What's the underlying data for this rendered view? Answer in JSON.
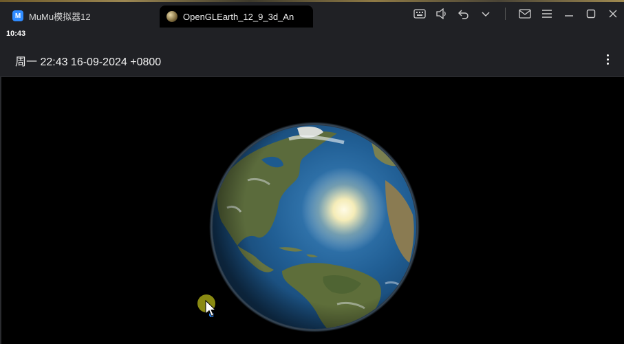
{
  "window": {
    "app_title": "MuMu模拟器12",
    "app_logo": "M",
    "active_tab_title": "OpenGLEarth_12_9_3d_An"
  },
  "controls": {
    "icons": [
      "keyboard-icon",
      "volume-icon",
      "undo-icon",
      "chevron-down-icon",
      "mail-icon",
      "menu-icon",
      "minimize-icon",
      "maximize-icon",
      "close-icon"
    ]
  },
  "statusbar": {
    "time": "10:43"
  },
  "appbar": {
    "title": "周一 22:43 16-09-2024 +0800",
    "menu_icon": "more-vert-icon"
  },
  "colors": {
    "chrome": "#202125",
    "touch": "#8a8a12",
    "touch_dot": "#2f8bff",
    "ocean": "#1e4f86",
    "land": "#5a6a3a"
  }
}
